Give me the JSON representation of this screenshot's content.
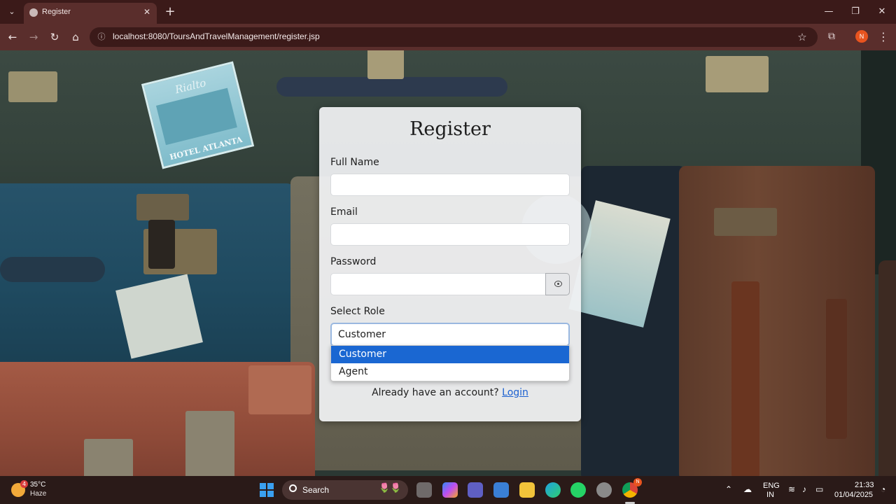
{
  "browser": {
    "tab_title": "Register",
    "url": "localhost:8080/ToursAndTravelManagement/register.jsp",
    "profile_initial": "N"
  },
  "form": {
    "title": "Register",
    "full_name_label": "Full Name",
    "full_name_value": "",
    "email_label": "Email",
    "email_value": "",
    "password_label": "Password",
    "password_value": "",
    "role_label": "Select Role",
    "role_selected": "Customer",
    "role_options": [
      "Customer",
      "Agent"
    ],
    "account_prompt": "Already have an account?",
    "login_link": "Login"
  },
  "background": {
    "sticker_hotel": "HOTEL ATLANTA",
    "sticker_hotel_script": "Rialto"
  },
  "taskbar": {
    "weather_temp": "35°C",
    "weather_condition": "Haze",
    "weather_badge": "4",
    "search_label": "Search",
    "lang_top": "ENG",
    "lang_bottom": "IN",
    "time": "21:33",
    "date": "01/04/2025",
    "chrome_badge": "N"
  },
  "colors": {
    "chrome_dark": "#3b1a19",
    "chrome_toolbar": "#5a2e2c",
    "option_highlight": "#1a67d2",
    "link": "#1a5fd0"
  }
}
